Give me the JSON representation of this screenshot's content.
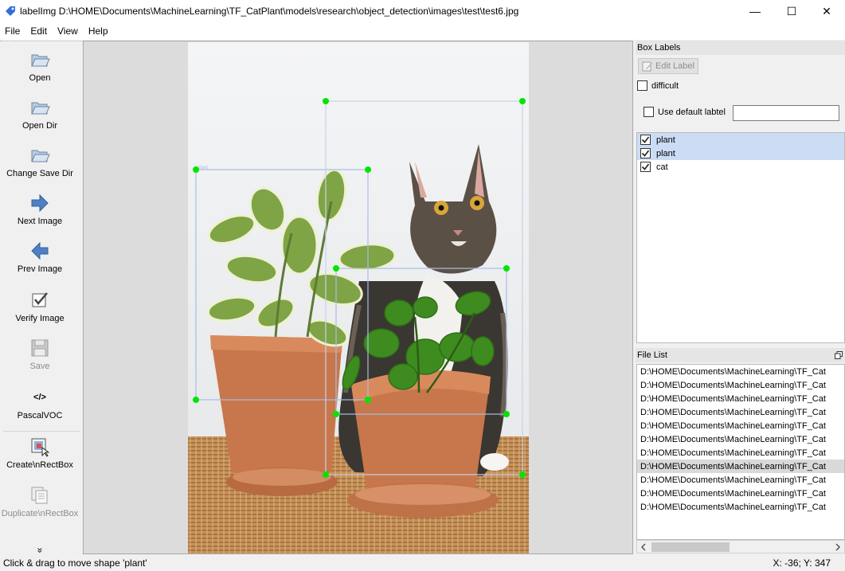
{
  "window": {
    "title": "labelImg D:\\HOME\\Documents\\MachineLearning\\TF_CatPlant\\models\\research\\object_detection\\images\\test\\test6.jpg",
    "minimize": "—",
    "maximize": "☐",
    "close": "✕"
  },
  "menu": [
    "File",
    "Edit",
    "View",
    "Help"
  ],
  "toolbar": {
    "open": "Open",
    "open_dir": "Open Dir",
    "change_save_dir": "Change Save Dir",
    "next_image": "Next Image",
    "prev_image": "Prev Image",
    "verify_image": "Verify Image",
    "save": "Save",
    "format_icon_text": "</>",
    "format": "PascalVOC",
    "create_rect": "Create\\nRectBox",
    "duplicate_rect": "Duplicate\\nRectBox",
    "more": "»"
  },
  "labels_panel": {
    "title": "Box Labels",
    "edit_label": "Edit Label",
    "difficult": "difficult",
    "use_default": "Use default labtel",
    "default_value": "",
    "items": [
      {
        "name": "plant",
        "checked": true,
        "selected": true
      },
      {
        "name": "plant",
        "checked": true,
        "selected": true
      },
      {
        "name": "cat",
        "checked": true,
        "selected": false
      }
    ]
  },
  "canvas": {
    "box_label": "plant"
  },
  "file_panel": {
    "title": "File List",
    "files": [
      "D:\\HOME\\Documents\\MachineLearning\\TF_Cat",
      "D:\\HOME\\Documents\\MachineLearning\\TF_Cat",
      "D:\\HOME\\Documents\\MachineLearning\\TF_Cat",
      "D:\\HOME\\Documents\\MachineLearning\\TF_Cat",
      "D:\\HOME\\Documents\\MachineLearning\\TF_Cat",
      "D:\\HOME\\Documents\\MachineLearning\\TF_Cat",
      "D:\\HOME\\Documents\\MachineLearning\\TF_Cat",
      "D:\\HOME\\Documents\\MachineLearning\\TF_Cat",
      "D:\\HOME\\Documents\\MachineLearning\\TF_Cat",
      "D:\\HOME\\Documents\\MachineLearning\\TF_Cat",
      "D:\\HOME\\Documents\\MachineLearning\\TF_Cat"
    ],
    "selected_index": 7
  },
  "status": {
    "message": "Click & drag to move shape 'plant'",
    "coords": "X: -36; Y: 347"
  },
  "colors": {
    "handle": "#00e600",
    "box": "#a8bde8",
    "selection": "#cddcf5"
  }
}
